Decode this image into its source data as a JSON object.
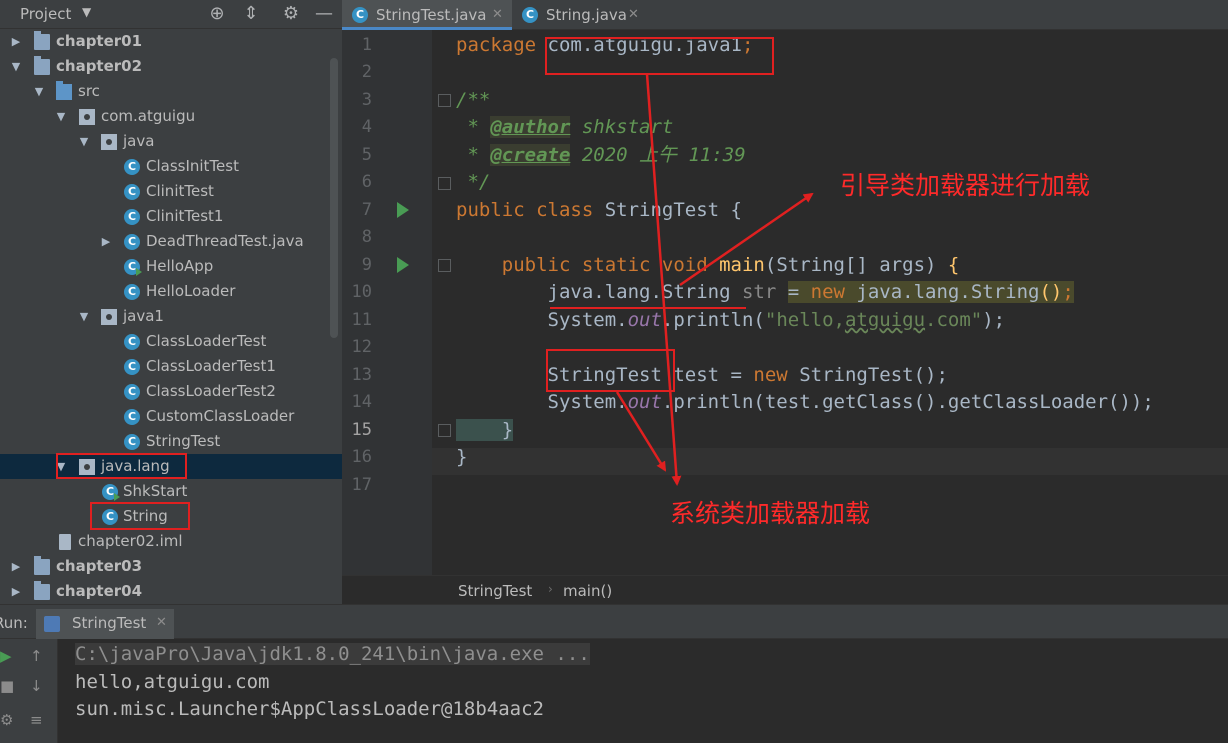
{
  "project_panel": {
    "title": "Project",
    "tree": [
      {
        "label": "chapter01",
        "kind": "module",
        "bold": true,
        "expanded": false
      },
      {
        "label": "chapter02",
        "kind": "module",
        "bold": true,
        "expanded": true
      },
      {
        "label": "src",
        "kind": "source",
        "expanded": true
      },
      {
        "label": "com.atguigu",
        "kind": "package",
        "expanded": true
      },
      {
        "label": "java",
        "kind": "package",
        "expanded": true
      },
      {
        "label": "ClassInitTest",
        "kind": "class"
      },
      {
        "label": "ClinitTest",
        "kind": "class"
      },
      {
        "label": "ClinitTest1",
        "kind": "class"
      },
      {
        "label": "DeadThreadTest.java",
        "kind": "class",
        "expanded": false
      },
      {
        "label": "HelloApp",
        "kind": "class-run"
      },
      {
        "label": "HelloLoader",
        "kind": "class"
      },
      {
        "label": "java1",
        "kind": "package",
        "expanded": true
      },
      {
        "label": "ClassLoaderTest",
        "kind": "class"
      },
      {
        "label": "ClassLoaderTest1",
        "kind": "class"
      },
      {
        "label": "ClassLoaderTest2",
        "kind": "class"
      },
      {
        "label": "CustomClassLoader",
        "kind": "class"
      },
      {
        "label": "StringTest",
        "kind": "class"
      },
      {
        "label": "java.lang",
        "kind": "package",
        "expanded": true,
        "selected": true
      },
      {
        "label": "ShkStart",
        "kind": "class-run"
      },
      {
        "label": "String",
        "kind": "class"
      },
      {
        "label": "chapter02.iml",
        "kind": "iml"
      },
      {
        "label": "chapter03",
        "kind": "module",
        "bold": true,
        "expanded": false
      },
      {
        "label": "chapter04",
        "kind": "module",
        "bold": true,
        "expanded": false
      }
    ]
  },
  "editor": {
    "tabs": [
      {
        "label": "StringTest.java",
        "active": true,
        "icon": "C"
      },
      {
        "label": "String.java",
        "active": false,
        "icon": "C"
      }
    ],
    "current_line": 15,
    "line_numbers": [
      "1",
      "2",
      "3",
      "4",
      "5",
      "6",
      "7",
      "8",
      "9",
      "10",
      "11",
      "12",
      "13",
      "14",
      "15",
      "16",
      "17"
    ],
    "code": {
      "l1_kw": "package ",
      "l1_pkg": "com.atguigu.java1",
      "l1_semi": ";",
      "l3": "/**",
      "l4_pre": " * ",
      "l4_tag": "@author",
      "l4_val": " shkstart",
      "l5_pre": " * ",
      "l5_tag": "@create",
      "l5_val": " 2020 上午 11:39",
      "l6": " */",
      "l7_kw": "public class ",
      "l7_rest": "StringTest {",
      "l9_kw": "    public static void ",
      "l9_fn": "main",
      "l9_rest": "(String[] args) ",
      "l9_brace": "{",
      "l10_type": "        java.lang.String",
      "l10_var": " str ",
      "l10_eq": "=",
      "l10_sp": " ",
      "l10_new": "new",
      "l10_ctor": " java.lang.String",
      "l10_paren": "()",
      "l10_semi": ";",
      "l11_pre": "        System.",
      "l11_out": "out",
      "l11_call": ".println(",
      "l11_str_a": "\"hello,",
      "l11_str_b": "atguigu",
      "l11_str_c": ".com\"",
      "l11_end": ");",
      "l13_type": "        StringTest",
      "l13_mid": " test = ",
      "l13_new": "new",
      "l13_end": " StringTest();",
      "l14_pre": "        System.",
      "l14_out": "out",
      "l14_end": ".println(test.getClass().getClassLoader());",
      "l15": "    }",
      "l16": "}"
    },
    "breadcrumb": [
      "StringTest",
      "main()"
    ]
  },
  "run_panel": {
    "label": "Run:",
    "tab_label": "StringTest",
    "console": [
      "C:\\javaPro\\Java\\jdk1.8.0_241\\bin\\java.exe ...",
      "hello,atguigu.com",
      "sun.misc.Launcher$AppClassLoader@18b4aac2"
    ]
  },
  "annotations": {
    "bootstrap_loader": "引导类加载器进行加载",
    "system_loader": "系统类加载器加载",
    "color": "#e02020"
  },
  "colors": {
    "keyword": "#cc7832",
    "doc_comment": "#629755",
    "string": "#6a8759",
    "field": "#9876aa",
    "method": "#ffc66d",
    "selection": "#0d293e",
    "accent": "#4a88c7"
  }
}
